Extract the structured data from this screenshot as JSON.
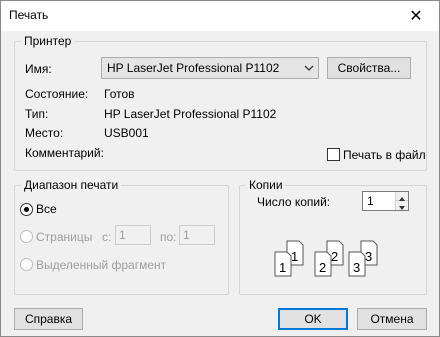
{
  "window": {
    "title": "Печать"
  },
  "printer": {
    "group_title": "Принтер",
    "name_label": "Имя:",
    "name_value": "HP LaserJet Professional P1102",
    "properties_button": "Свойства...",
    "status_label": "Состояние:",
    "status_value": "Готов",
    "type_label": "Тип:",
    "type_value": "HP LaserJet Professional P1102",
    "where_label": "Место:",
    "where_value": "USB001",
    "comment_label": "Комментарий:",
    "print_to_file_label": "Печать в файл",
    "print_to_file_checked": false
  },
  "range": {
    "group_title": "Диапазон печати",
    "all_label": "Все",
    "all_selected": true,
    "pages_label": "Страницы",
    "from_label": "с:",
    "from_value": "1",
    "to_label": "по:",
    "to_value": "1",
    "selection_label": "Выделенный фрагмент"
  },
  "copies": {
    "group_title": "Копии",
    "count_label": "Число копий:",
    "count_value": "1",
    "collate_page_numbers": [
      "1",
      "1",
      "2",
      "2",
      "3",
      "3"
    ]
  },
  "buttons": {
    "help": "Справка",
    "ok": "OK",
    "cancel": "Отмена"
  },
  "icons": {
    "close": "close-icon",
    "dropdown": "chevron-down-icon",
    "spin_up": "arrow-up-icon",
    "spin_down": "arrow-down-icon",
    "collate": "collate-pages-icon"
  }
}
